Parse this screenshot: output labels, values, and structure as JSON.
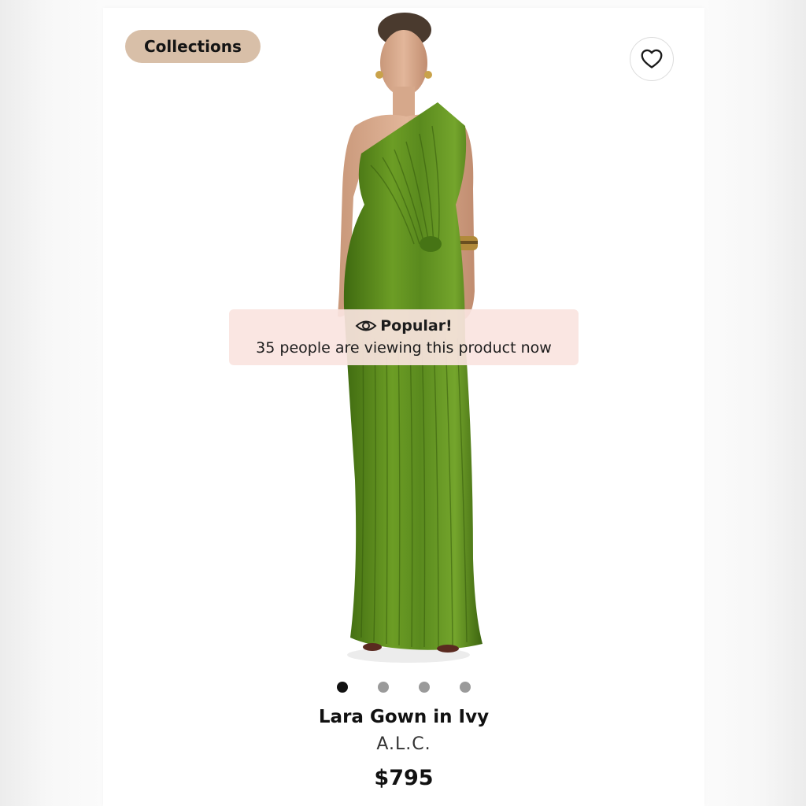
{
  "header": {
    "collections_label": "Collections"
  },
  "favorite": {
    "icon": "heart-outline-icon"
  },
  "product_image": {
    "alt": "Model wearing a green pleated one-shoulder gown",
    "dress_color": "#5a8a1e"
  },
  "popular_banner": {
    "icon": "eye-icon",
    "title": "Popular!",
    "text": "35 people are viewing this product now",
    "background": "#fae4e0"
  },
  "carousel": {
    "total": 4,
    "active_index": 0
  },
  "product": {
    "name": "Lara Gown in Ivy",
    "brand": "A.L.C.",
    "price": "$795"
  },
  "colors": {
    "pill": "#d8bfa8",
    "text": "#111111"
  }
}
